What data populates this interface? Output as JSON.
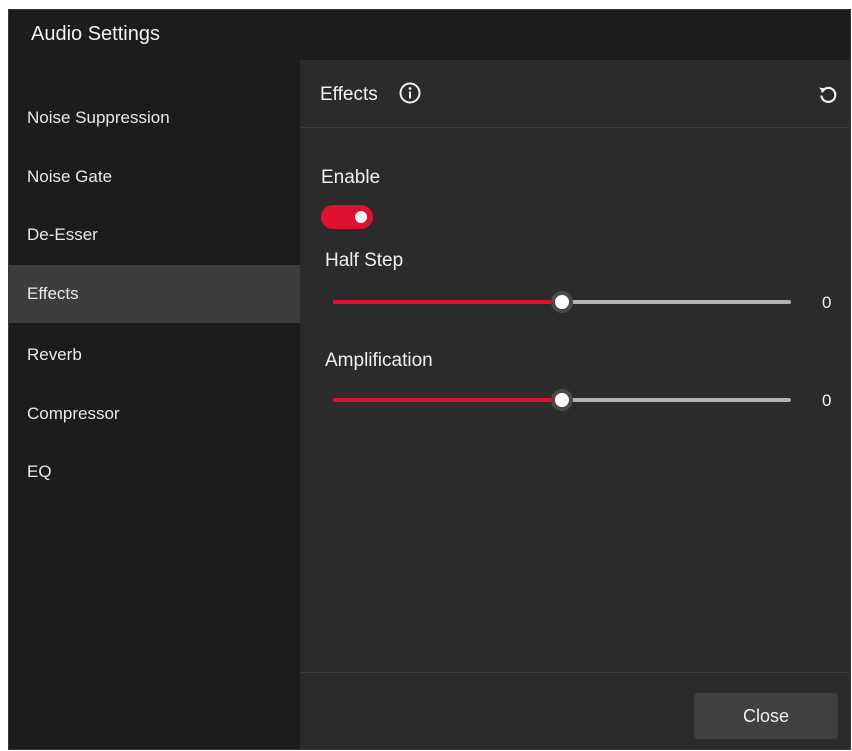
{
  "window": {
    "title": "Audio Settings"
  },
  "sidebar": {
    "items": [
      {
        "label": "Noise Suppression"
      },
      {
        "label": "Noise Gate"
      },
      {
        "label": "De-Esser"
      },
      {
        "label": "Effects",
        "active": true
      },
      {
        "label": "Reverb"
      },
      {
        "label": "Compressor"
      },
      {
        "label": "EQ"
      }
    ]
  },
  "panel": {
    "title": "Effects",
    "info_icon": "info-icon",
    "reset_icon": "reset-icon",
    "enable": {
      "label": "Enable",
      "on": true
    },
    "half_step": {
      "label": "Half Step",
      "value": "0",
      "position": 0.5
    },
    "amplification": {
      "label": "Amplification",
      "value": "0",
      "position": 0.5
    }
  },
  "footer": {
    "close_label": "Close"
  },
  "colors": {
    "accent": "#e01030",
    "window_bg": "#232323",
    "sidebar_bg": "#1c1c1c",
    "active_item_bg": "#3d3d3d",
    "content_bg": "#2b2b2b",
    "button_bg": "#404040"
  }
}
